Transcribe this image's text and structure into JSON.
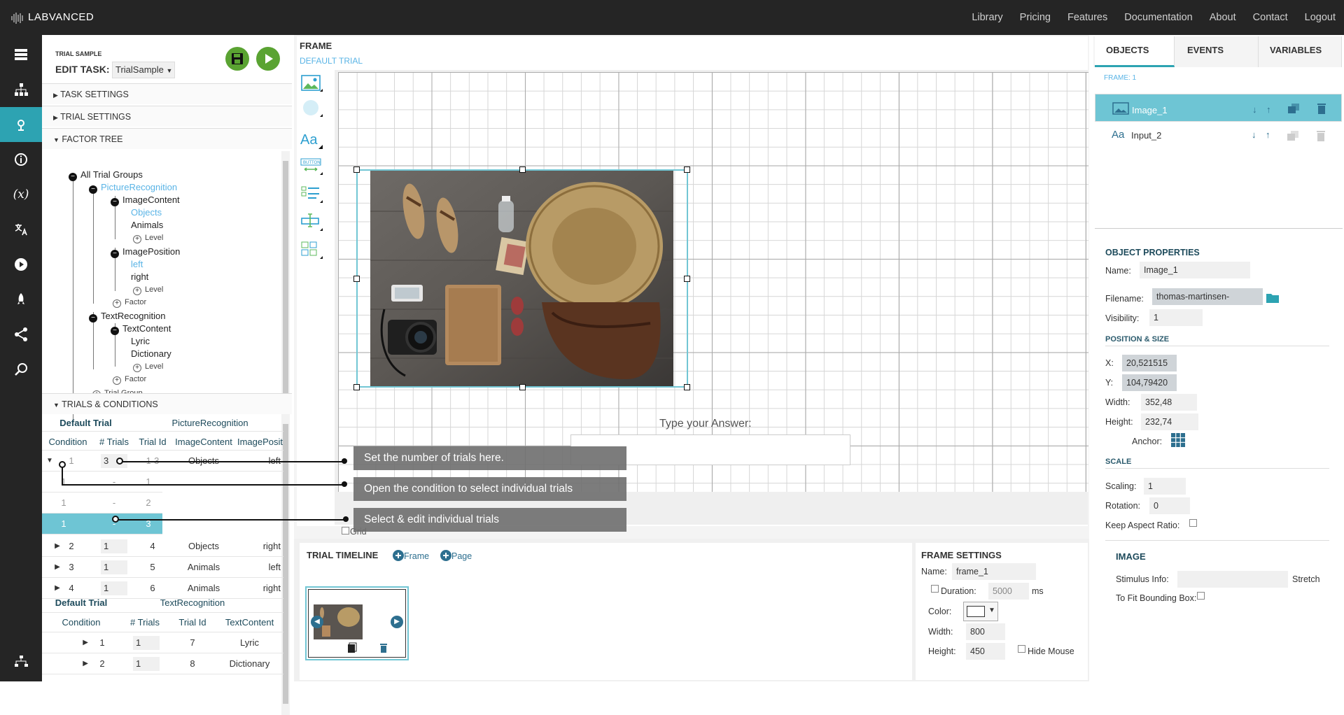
{
  "app": {
    "logo": "LABVANCED"
  },
  "topnav": [
    "Library",
    "Pricing",
    "Features",
    "Documentation",
    "About",
    "Contact",
    "Logout"
  ],
  "left_panel": {
    "small_title": "TRIAL SAMPLE",
    "edit_label": "EDIT TASK:",
    "task_select": "TrialSample",
    "sections": {
      "task_settings": "TASK SETTINGS",
      "trial_settings": "TRIAL SETTINGS",
      "factor_tree": "FACTOR TREE",
      "trials_conditions": "TRIALS & CONDITIONS"
    }
  },
  "factor_tree": {
    "root": "All Trial Groups",
    "group1": "PictureRecognition",
    "factor1": "ImageContent",
    "f1_levels": [
      "Objects",
      "Animals"
    ],
    "level_label": "Level",
    "factor2": "ImagePosition",
    "f2_levels": [
      "left",
      "right"
    ],
    "factor_label": "Factor",
    "group2": "TextRecognition",
    "factor3": "TextContent",
    "f3_levels": [
      "Lyric",
      "Dictionary"
    ],
    "trial_group_label": "Trial Group"
  },
  "table1": {
    "group_title": "Default Trial",
    "group_name": "PictureRecognition",
    "headers": [
      "Condition",
      "# Trials",
      "Trial Id",
      "ImageContent",
      "ImagePosit"
    ],
    "rows": [
      {
        "cond": "1",
        "trials": "3",
        "id": "1-3",
        "content": "Objects",
        "pos": "left"
      },
      {
        "cond": "2",
        "trials": "1",
        "id": "4",
        "content": "Objects",
        "pos": "right"
      },
      {
        "cond": "3",
        "trials": "1",
        "id": "5",
        "content": "Animals",
        "pos": "left"
      },
      {
        "cond": "4",
        "trials": "1",
        "id": "6",
        "content": "Animals",
        "pos": "right"
      }
    ],
    "subrows": [
      {
        "cond": "1",
        "trials": "-",
        "id": "1"
      },
      {
        "cond": "1",
        "trials": "-",
        "id": "2"
      },
      {
        "cond": "1",
        "trials": "-",
        "id": "3"
      }
    ]
  },
  "table2": {
    "group_title": "Default Trial",
    "group_name": "TextRecognition",
    "headers": [
      "Condition",
      "# Trials",
      "Trial Id",
      "TextContent"
    ],
    "rows": [
      {
        "cond": "1",
        "trials": "1",
        "id": "7",
        "content": "Lyric"
      },
      {
        "cond": "2",
        "trials": "1",
        "id": "8",
        "content": "Dictionary"
      }
    ]
  },
  "callouts": [
    "Set the number of trials here.",
    "Open the condition to select individual trials",
    "Select & edit individual trials"
  ],
  "frame": {
    "title": "FRAME",
    "subtitle": "DEFAULT TRIAL",
    "type_answer": "Type your Answer:",
    "grid_label": "Grid"
  },
  "timeline": {
    "title": "TRIAL TIMELINE",
    "add_frame": "Frame",
    "add_page": "Page"
  },
  "frame_settings": {
    "title": "FRAME SETTINGS",
    "name_label": "Name:",
    "name_value": "frame_1",
    "duration_label": "Duration:",
    "duration_value": "5000",
    "duration_unit": "ms",
    "color_label": "Color:",
    "width_label": "Width:",
    "width_value": "800",
    "height_label": "Height:",
    "height_value": "450",
    "hide_mouse": "Hide Mouse"
  },
  "right_tabs": [
    "OBJECTS",
    "EVENTS",
    "VARIABLES"
  ],
  "objects": {
    "frame_label": "FRAME: 1",
    "items": [
      "Image_1",
      "Input_2"
    ]
  },
  "properties": {
    "title": "OBJECT PROPERTIES",
    "name_label": "Name:",
    "name_value": "Image_1",
    "filename_label": "Filename:",
    "filename_value": "thomas-martinsen-",
    "visibility_label": "Visibility:",
    "visibility_value": "1",
    "pos_title": "POSITION & SIZE",
    "x_label": "X:",
    "x_value": "20,521515",
    "y_label": "Y:",
    "y_value": "104,79420",
    "width_label": "Width:",
    "width_value": "352,48",
    "height_label": "Height:",
    "height_value": "232,74",
    "anchor_label": "Anchor:",
    "scale_title": "SCALE",
    "scaling_label": "Scaling:",
    "scaling_value": "1",
    "rotation_label": "Rotation:",
    "rotation_value": "0",
    "aspect_label": "Keep Aspect Ratio:",
    "image_title": "IMAGE",
    "stimulus_label": "Stimulus Info:",
    "stretch_label": "Stretch",
    "fit_label": "To Fit Bounding Box:"
  },
  "colors": {
    "accent": "#2da3b2",
    "selected_row": "#6ec5d4",
    "topbar": "#252525",
    "play": "#5aa332"
  }
}
